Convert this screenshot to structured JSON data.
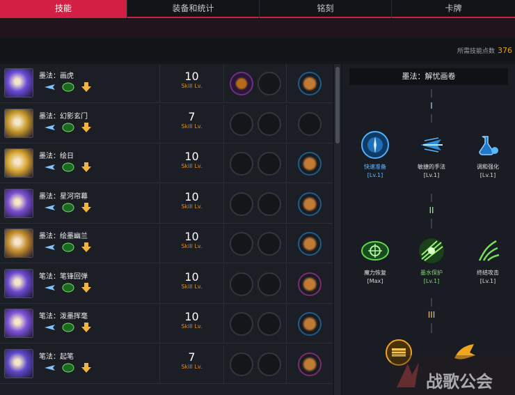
{
  "tabs": [
    "技能",
    "装备和统计",
    "铭刻",
    "卡牌"
  ],
  "points": {
    "label": "所需技能点数",
    "value": "376"
  },
  "skills": [
    {
      "name": "墨法：画虎",
      "lv": "10",
      "lv_label": "Skill Lv.",
      "rune1_filled": true,
      "card": "blue",
      "icon_color": "#6a4bd8"
    },
    {
      "name": "墨法：幻影玄门",
      "lv": "7",
      "lv_label": "Skill Lv.",
      "rune1_filled": false,
      "card": "empty",
      "icon_color": "#c89a2a"
    },
    {
      "name": "墨法：绘日",
      "lv": "10",
      "lv_label": "Skill Lv.",
      "rune1_filled": false,
      "card": "blue",
      "icon_color": "#d8a530"
    },
    {
      "name": "墨法：星河帘幕",
      "lv": "10",
      "lv_label": "Skill Lv.",
      "rune1_filled": false,
      "card": "blue",
      "icon_color": "#7a4ed0"
    },
    {
      "name": "墨法：绘墨幽兰",
      "lv": "10",
      "lv_label": "Skill Lv.",
      "rune1_filled": false,
      "card": "blue",
      "icon_color": "#c28b2b"
    },
    {
      "name": "笔法：笔锋回弹",
      "lv": "10",
      "lv_label": "Skill Lv.",
      "rune1_filled": false,
      "card": "purple",
      "icon_color": "#6c4ad0"
    },
    {
      "name": "笔法：泼墨挥毫",
      "lv": "10",
      "lv_label": "Skill Lv.",
      "rune1_filled": false,
      "card": "blue",
      "icon_color": "#7d52d8"
    },
    {
      "name": "笔法：起笔",
      "lv": "7",
      "lv_label": "Skill Lv.",
      "rune1_filled": false,
      "card": "purple",
      "icon_color": "#5f48c8"
    }
  ],
  "detail": {
    "title": "墨法：解忧画卷",
    "tiers": [
      "I",
      "II",
      "III"
    ],
    "tier1": [
      {
        "name": "快速准备",
        "lv": "[Lv.1]",
        "state": "sel-blue"
      },
      {
        "name": "敏捷的手法",
        "lv": "[Lv.1]",
        "state": "normal"
      },
      {
        "name": "调和强化",
        "lv": "[Lv.1]",
        "state": "normal"
      }
    ],
    "tier2": [
      {
        "name": "魔力恢复",
        "lv": "[Max]",
        "state": "normal"
      },
      {
        "name": "墨水保护",
        "lv": "[Lv.1]",
        "state": "sel-green"
      },
      {
        "name": "终结攻击",
        "lv": "[Lv.1]",
        "state": "normal"
      }
    ]
  },
  "watermark": "战歌公会",
  "colors": {
    "accent": "#d31f43",
    "gold": "#e3a21a",
    "blue": "#6bb8ff",
    "green": "#79e05b"
  }
}
